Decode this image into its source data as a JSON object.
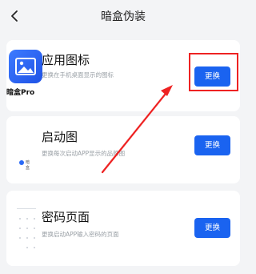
{
  "header": {
    "title": "暗盒伪装"
  },
  "cards": [
    {
      "title": "应用图标",
      "desc": "更换在手机桌面显示的图标",
      "button": "更换",
      "app_name": "暗盒Pro"
    },
    {
      "title": "启动图",
      "desc": "更换每次启动APP显示的品牌图",
      "button": "更换",
      "logo_text": "暗盒"
    },
    {
      "title": "密码页面",
      "desc": "更换启动APP输入密码的页面",
      "button": "更换"
    }
  ],
  "colors": {
    "accent": "#1a63f0",
    "highlight": "#ee2222",
    "background": "#f3f4f6"
  },
  "icons": {
    "back": "chevron-left-icon",
    "app": "image-icon"
  }
}
